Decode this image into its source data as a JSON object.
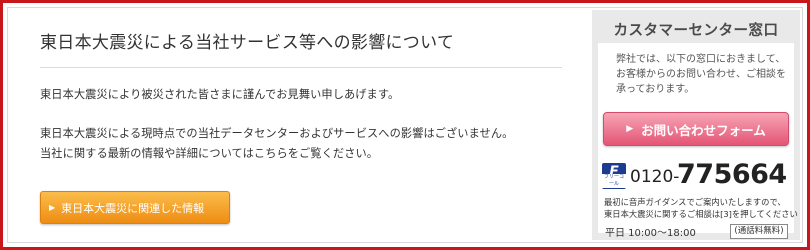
{
  "notice": {
    "title": "東日本大震災による当社サービス等への影響について",
    "paragraph1": "東日本大震災により被災された皆さまに謹んでお見舞い申しあげます。",
    "paragraph2_line1": "東日本大震災による現時点での当社データセンターおよびサービスへの影響はございません。",
    "paragraph2_line2": "当社に関する最新の情報や詳細についてはこちらをご覧ください。",
    "related_button_label": "東日本大震災に関連した情報",
    "arrow_glyph": "▶"
  },
  "customer_center": {
    "title": "カスタマーセンター窓口",
    "description": "弊社では、以下の窓口におきまして、お客様からのお問い合わせ、ご相談を承っております。",
    "contact_button_label": "お問い合わせフォーム",
    "freecall_logo_mark": "F",
    "freecall_logo_text": "フリーコール",
    "phone_prefix": "0120-",
    "phone_main": "775664",
    "note_line1": "最初に音声ガイダンスでご案内いたしますので、",
    "note_line2": "東日本大震災に関するご相談は[3]を押してください",
    "hours": "平日 10:00〜18:00",
    "free_badge": "(通話料無料)"
  },
  "colors": {
    "frame_red": "#c8161d",
    "orange_button": "#ee8d14",
    "pink_button": "#e45575",
    "freecall_blue": "#1d3b8f"
  },
  "icons": {
    "related_arrow": "triangle-right-icon",
    "contact_arrow": "triangle-right-icon",
    "freecall": "freecall-logo-icon"
  }
}
